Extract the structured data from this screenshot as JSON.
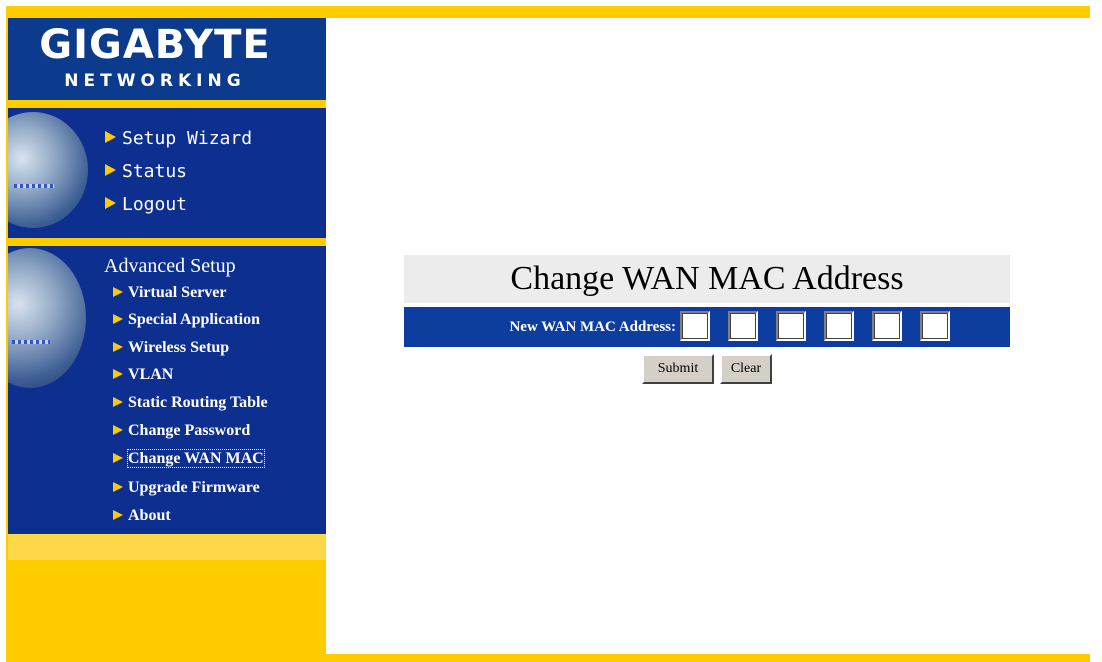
{
  "brand": {
    "logo_main": "GIGABYTE",
    "logo_sub": "NETWORKING"
  },
  "sidebar": {
    "nav_items": [
      {
        "label": "Setup Wizard",
        "icon": "arrow-right-icon"
      },
      {
        "label": "Status",
        "icon": "arrow-right-icon"
      },
      {
        "label": "Logout",
        "icon": "arrow-right-icon"
      }
    ],
    "advanced_heading": "Advanced Setup",
    "advanced_items": [
      {
        "label": "Virtual Server"
      },
      {
        "label": "Special Application"
      },
      {
        "label": "Wireless Setup"
      },
      {
        "label": "VLAN"
      },
      {
        "label": "Static Routing Table"
      },
      {
        "label": "Change Password"
      },
      {
        "label": "Change WAN MAC",
        "selected": true
      },
      {
        "label": "Upgrade Firmware"
      },
      {
        "label": "About"
      }
    ]
  },
  "form": {
    "title": "Change WAN MAC Address",
    "field_label": "New WAN MAC Address:",
    "mac_octets": [
      "",
      "",
      "",
      "",
      "",
      ""
    ],
    "submit_label": "Submit",
    "clear_label": "Clear"
  },
  "colors": {
    "brand_blue": "#0d2f8f",
    "form_blue": "#0d3d9e",
    "accent_yellow": "#ffcc00",
    "title_bg": "#ececec"
  }
}
